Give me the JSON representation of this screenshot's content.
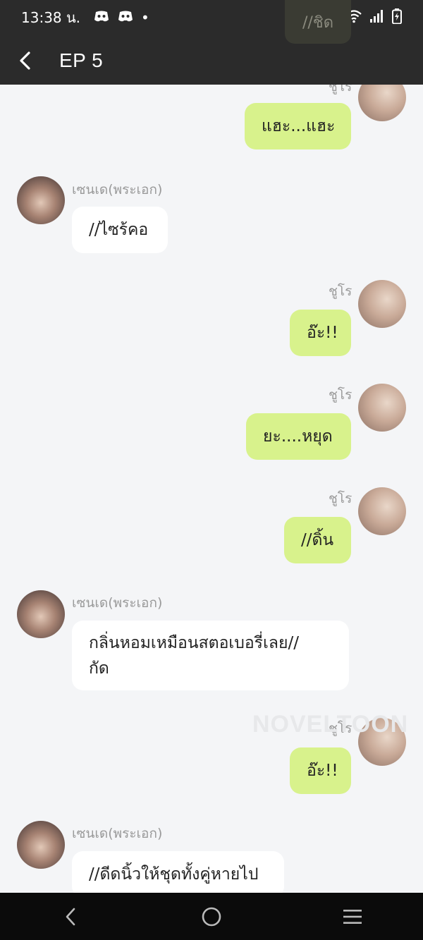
{
  "status_bar": {
    "time": "13:38 น.",
    "dot": "•"
  },
  "header": {
    "title": "EP 5"
  },
  "top_ghost_text": "//ชิด",
  "chat": {
    "messages": [
      {
        "sender": "ชูโร",
        "side": "right",
        "text": "แฮะ...แฮะ"
      },
      {
        "sender": "เซนเด(พระเอก)",
        "side": "left",
        "text": "//ไซร้คอ"
      },
      {
        "sender": "ชูโร",
        "side": "right",
        "text": "อ๊ะ!!"
      },
      {
        "sender": "ชูโร",
        "side": "right",
        "text": "ยะ....หยุด"
      },
      {
        "sender": "ชูโร",
        "side": "right",
        "text": "//ดิ้น"
      },
      {
        "sender": "เซนเด(พระเอก)",
        "side": "left",
        "text": "กลิ่นหอมเหมือนสตอเบอรี่เลย//",
        "text2": "กัด"
      },
      {
        "sender": "ชูโร",
        "side": "right",
        "text": "อ๊ะ!!"
      },
      {
        "sender": "เซนเด(พระเอก)",
        "side": "left",
        "text": "//ดีดนิ้วให้ชุดทั้งคู่หายไป"
      }
    ]
  },
  "watermark": "NOVELTOON",
  "colors": {
    "header_bg": "#2b2b2b",
    "my_bubble": "#d8f28c",
    "other_bubble": "#ffffff",
    "chat_bg": "#f4f5f7"
  },
  "icons": [
    "discord-icon",
    "wifi-icon",
    "signal-icon",
    "battery-icon",
    "back-arrow-icon",
    "nav-back-icon",
    "nav-home-icon",
    "nav-recents-icon"
  ]
}
